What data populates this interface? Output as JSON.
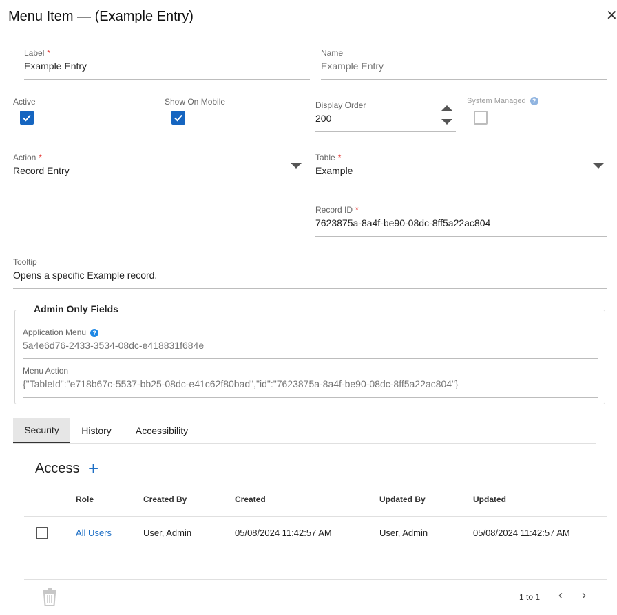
{
  "dialog": {
    "title": "Menu Item — (Example Entry)",
    "close_icon": "close-icon"
  },
  "form": {
    "label": {
      "label": "Label",
      "required": "*",
      "value": "Example Entry"
    },
    "name": {
      "label": "Name",
      "value": "Example Entry"
    },
    "active": {
      "label": "Active",
      "checked": true
    },
    "show_on_mobile": {
      "label": "Show On Mobile",
      "checked": true
    },
    "display_order": {
      "label": "Display Order",
      "value": "200"
    },
    "system_managed": {
      "label": "System Managed",
      "checked": false,
      "help": "?"
    },
    "action": {
      "label": "Action",
      "required": "*",
      "value": "Record Entry"
    },
    "table": {
      "label": "Table",
      "required": "*",
      "value": "Example"
    },
    "record_id": {
      "label": "Record ID",
      "required": "*",
      "value": "7623875a-8a4f-be90-08dc-8ff5a22ac804"
    },
    "tooltip": {
      "label": "Tooltip",
      "value": "Opens a specific Example record."
    }
  },
  "admin": {
    "legend": "Admin Only Fields",
    "application_menu": {
      "label": "Application Menu",
      "help": "?",
      "value": "5a4e6d76-2433-3534-08dc-e418831f684e"
    },
    "menu_action": {
      "label": "Menu Action",
      "value": "{\"TableId\":\"e718b67c-5537-bb25-08dc-e41c62f80bad\",\"id\":\"7623875a-8a4f-be90-08dc-8ff5a22ac804\"}"
    }
  },
  "tabs": [
    {
      "label": "Security",
      "active": true
    },
    {
      "label": "History",
      "active": false
    },
    {
      "label": "Accessibility",
      "active": false
    }
  ],
  "access": {
    "title": "Access",
    "add": "+",
    "columns": [
      "Role",
      "Created By",
      "Created",
      "Updated By",
      "Updated"
    ],
    "rows": [
      {
        "role": "All Users",
        "created_by": "User, Admin",
        "created": "05/08/2024 11:42:57 AM",
        "updated_by": "User, Admin",
        "updated": "05/08/2024 11:42:57 AM"
      }
    ]
  },
  "pager": {
    "text": "1 to 1",
    "prev": "‹",
    "next": "›"
  },
  "colors": {
    "accent": "#1565c0",
    "link": "#1e6fc5",
    "required": "#e53935"
  }
}
